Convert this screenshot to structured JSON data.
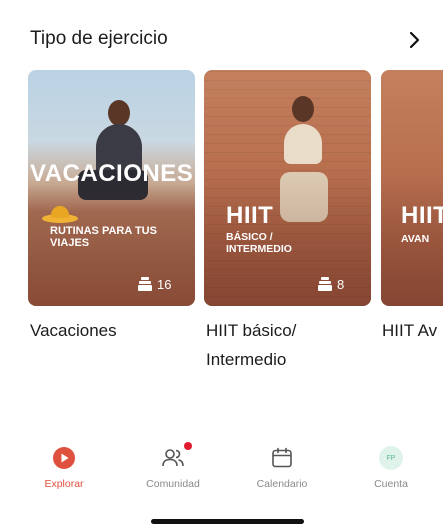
{
  "section": {
    "title": "Tipo de ejercicio"
  },
  "cards": [
    {
      "image_title": "VACACIONES",
      "image_subtitle": "RUTINAS PARA TUS VIAJES",
      "count": "16",
      "label": "Vacaciones"
    },
    {
      "image_title": "HIIT",
      "image_subtitle": "BÁSICO / INTERMEDIO",
      "count": "8",
      "label": "HIIT básico/ Intermedio"
    },
    {
      "image_title": "HIIT",
      "image_subtitle": "AVAN",
      "label": "HIIT Av"
    }
  ],
  "tabs": [
    {
      "label": "Explorar",
      "icon": "play-circle-icon",
      "active": true
    },
    {
      "label": "Comunidad",
      "icon": "people-icon",
      "notification_dot": true
    },
    {
      "label": "Calendario",
      "icon": "calendar-icon"
    },
    {
      "label": "Cuenta",
      "icon": "avatar-initials",
      "initials": "FP"
    }
  ],
  "colors": {
    "accent": "#e0503f",
    "inactive": "#8a8a8a"
  }
}
